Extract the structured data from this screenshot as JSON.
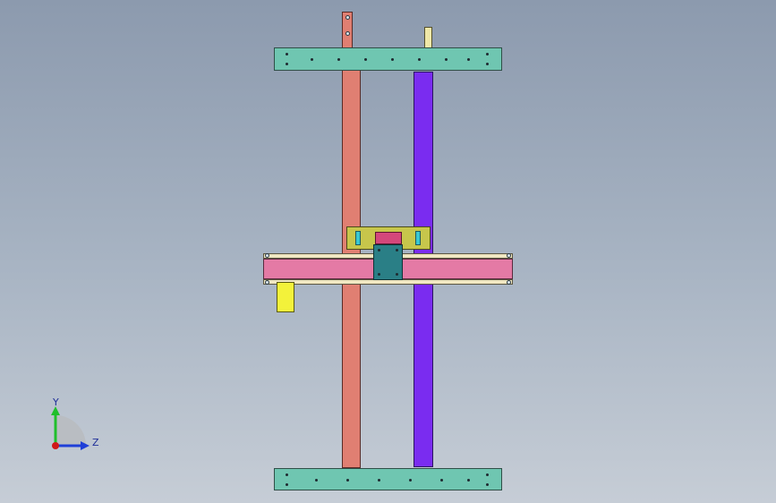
{
  "window": {
    "background_top": "#8c9aae",
    "background_bottom": "#c6cdd6"
  },
  "model": {
    "plates_color": "#6fc6b1",
    "rail_left_color": "#e07f72",
    "rail_right_color": "#7a2cf0",
    "crossbeam_color": "#e47aa5",
    "carriage_color": "#c7c64b",
    "block_color": "#2a7f86",
    "motor_color": "#f3f23a"
  },
  "triad": {
    "y_label": "Y",
    "z_label": "Z",
    "y_color": "#1fbf2b",
    "z_color": "#1f3fd8",
    "x_color": "#d01818"
  }
}
